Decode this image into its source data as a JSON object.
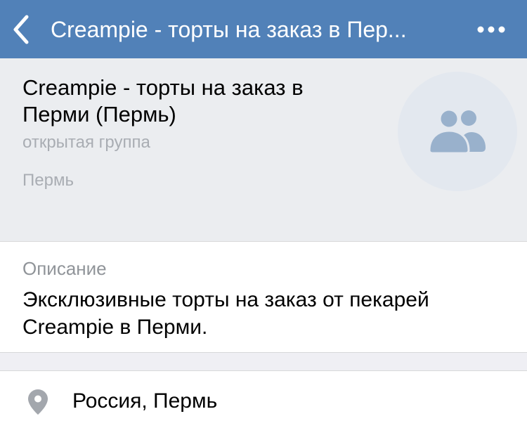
{
  "colors": {
    "navbar_bg": "#5181b8",
    "header_bg": "#ebedf0",
    "avatar_bg": "#e3e8ef",
    "avatar_icon": "#99b1cc",
    "secondary_text": "#a9adb3",
    "pin_icon": "#a3a7ad"
  },
  "navbar": {
    "title": "Creampie - торты на заказ в Пер...",
    "back_icon": "chevron-left-icon",
    "more_icon": "more-horizontal-icon"
  },
  "group": {
    "name": "Creampie - торты на заказ в Перми (Пермь)",
    "type": "открытая группа",
    "city": "Пермь",
    "avatar_icon": "users-icon"
  },
  "description": {
    "label": "Описание",
    "text": "Эксклюзивные торты на заказ от пекарей Creampie в Перми."
  },
  "location": {
    "icon": "map-pin-icon",
    "text": "Россия, Пермь"
  }
}
